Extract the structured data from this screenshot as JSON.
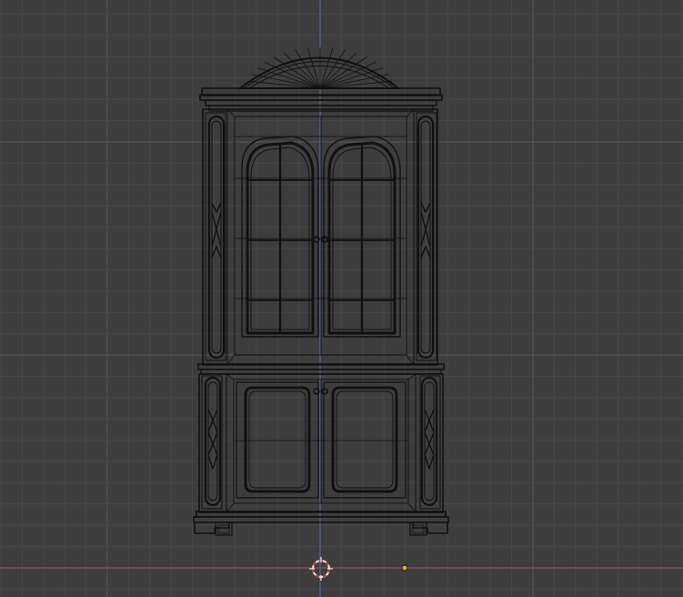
{
  "viewport": {
    "view": "front-orthographic",
    "wireframe": true,
    "grid": true
  },
  "scene": {
    "object": "display-cabinet",
    "parts": [
      "pediment-sunburst",
      "cornice",
      "upper-glass-doors",
      "side-pilasters",
      "waist-molding",
      "lower-panel-doors",
      "door-knobs",
      "plinth",
      "bracket-feet"
    ]
  },
  "colors": {
    "background": "#3d3d3d",
    "grid_minor": "#484848",
    "grid_major": "#565656",
    "axis_x": "#9a4a55",
    "axis_z": "#4f6ea3",
    "wire": "#111111",
    "cursor_ring": "#e8e8e8",
    "cursor_dash": "#c0392b",
    "origin": "#e8a33c"
  },
  "icons": {
    "cursor": "3d-cursor-icon",
    "origin": "object-origin-icon"
  }
}
